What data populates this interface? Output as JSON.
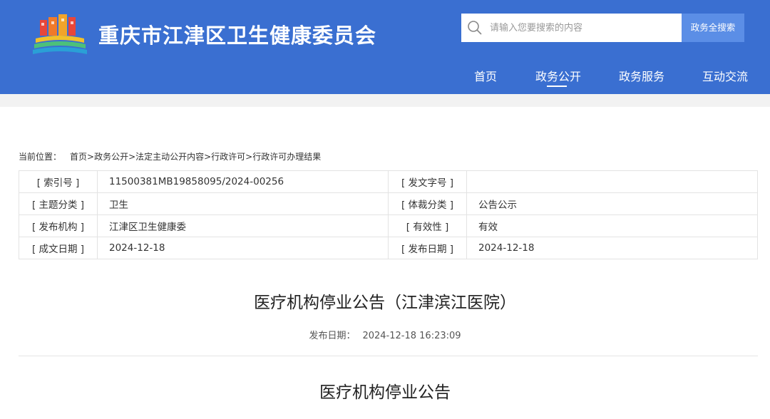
{
  "header": {
    "site_title": "重庆市江津区卫生健康委员会",
    "search": {
      "placeholder": "请输入您要搜索的内容",
      "button_label": "政务全搜索"
    },
    "nav": [
      {
        "label": "首页",
        "active": false
      },
      {
        "label": "政务公开",
        "active": true
      },
      {
        "label": "政务服务",
        "active": false
      },
      {
        "label": "互动交流",
        "active": false
      }
    ],
    "colors": {
      "header_bg": "#3a6fd1",
      "search_button_bg": "#5b8ee6"
    }
  },
  "breadcrumb": {
    "label": "当前位置：",
    "path": "首页>政务公开>法定主动公开内容>行政许可>行政许可办理结果"
  },
  "info_table": {
    "rows": [
      {
        "k1": "[ 索引号 ]",
        "v1": "11500381MB19858095/2024-00256",
        "k2": "[ 发文字号 ]",
        "v2": ""
      },
      {
        "k1": "[ 主题分类 ]",
        "v1": "卫生",
        "k2": "[ 体裁分类 ]",
        "v2": "公告公示"
      },
      {
        "k1": "[ 发布机构 ]",
        "v1": "江津区卫生健康委",
        "k2": "[ 有效性 ]",
        "v2": "有效"
      },
      {
        "k1": "[ 成文日期 ]",
        "v1": "2024-12-18",
        "k2": "[ 发布日期 ]",
        "v2": "2024-12-18"
      }
    ]
  },
  "article": {
    "title": "医疗机构停业公告（江津滨江医院）",
    "publish_label": "发布日期：",
    "publish_time": "2024-12-18 16:23:09",
    "content_heading": "医疗机构停业公告"
  }
}
